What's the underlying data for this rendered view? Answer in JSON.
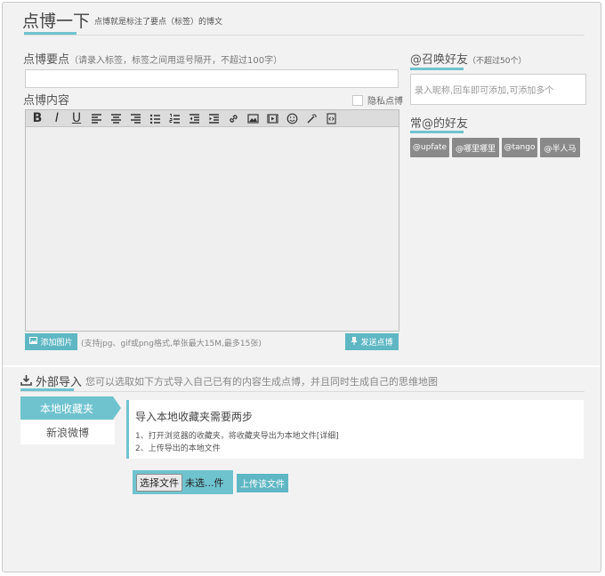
{
  "header": {
    "title": "点博一下",
    "subtitle": "点博就是标注了要点（标签）的博文"
  },
  "form": {
    "points_label": "点博要点",
    "points_hint": "（请录入标签，标签之间用逗号隔开，不超过100字）",
    "content_label": "点博内容",
    "private_label": "隐私点博",
    "upload_image_label": "添加图片",
    "upload_hint": "(支持jpg、gif或png格式,单张最大15M,最多15张)",
    "send_label": "发送点博"
  },
  "toolbar": {
    "items": [
      {
        "name": "bold-icon",
        "glyph": "B"
      },
      {
        "name": "italic-icon",
        "glyph": "I"
      },
      {
        "name": "underline-icon",
        "glyph": "U"
      },
      {
        "name": "align-left-icon"
      },
      {
        "name": "align-center-icon"
      },
      {
        "name": "align-right-icon"
      },
      {
        "name": "bullet-list-icon"
      },
      {
        "name": "numbered-list-icon"
      },
      {
        "name": "outdent-icon"
      },
      {
        "name": "indent-icon"
      },
      {
        "name": "link-icon"
      },
      {
        "name": "image-icon"
      },
      {
        "name": "video-icon"
      },
      {
        "name": "emoticon-icon"
      },
      {
        "name": "magic-wand-icon"
      },
      {
        "name": "source-code-icon"
      }
    ]
  },
  "friends": {
    "mention_title": "@召唤好友",
    "mention_limit": "（不超过50个）",
    "mention_placeholder": "录入昵称,回车即可添加,可添加多个",
    "frequent_title": "常@的好友",
    "tags": [
      "@upfate",
      "@哪里哪里",
      "@tango",
      "@半人马"
    ]
  },
  "import": {
    "title": "外部导入",
    "desc": "您可以选取如下方式导入自己已有的内容生成点博，并且同时生成自己的思维地图",
    "tabs": [
      "本地收藏夹",
      "新浪微博"
    ],
    "panel_title": "导入本地收藏夹需要两步",
    "step1": "1、打开浏览器的收藏夹，将收藏夹导出为本地文件[详细]",
    "step2": "2、上传导出的本地文件",
    "choose_file_label": "选择文件",
    "no_file_label": "未选...件",
    "upload_file_label": "上传该文件"
  },
  "colors": {
    "accent": "#6fc3cf",
    "button": "#5fb7c4",
    "tag": "#8a8a8a"
  }
}
